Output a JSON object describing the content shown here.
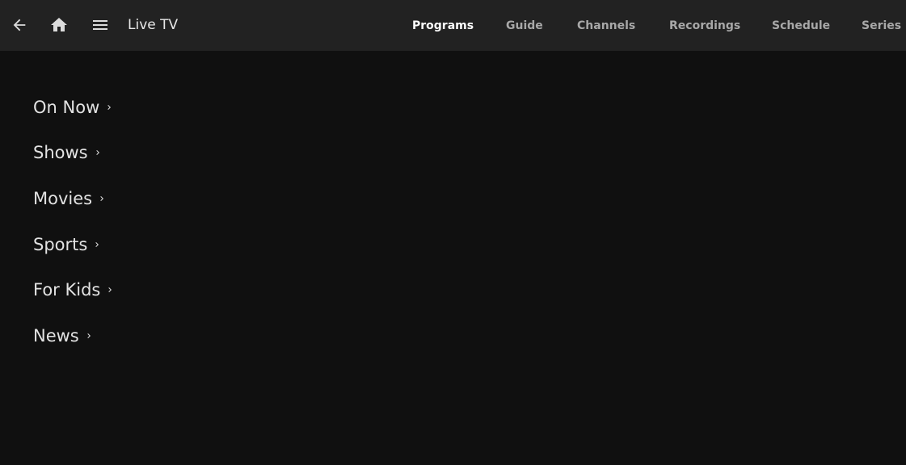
{
  "header": {
    "title": "Live TV",
    "icons": {
      "back": "arrow-back-icon",
      "home": "home-icon",
      "menu": "hamburger-menu-icon"
    },
    "tabs": [
      {
        "label": "Programs",
        "active": true
      },
      {
        "label": "Guide",
        "active": false
      },
      {
        "label": "Channels",
        "active": false
      },
      {
        "label": "Recordings",
        "active": false
      },
      {
        "label": "Schedule",
        "active": false
      },
      {
        "label": "Series",
        "active": false
      }
    ]
  },
  "sections": [
    {
      "label": "On Now"
    },
    {
      "label": "Shows"
    },
    {
      "label": "Movies"
    },
    {
      "label": "Sports"
    },
    {
      "label": "For Kids"
    },
    {
      "label": "News"
    }
  ],
  "colors": {
    "background": "#101010",
    "header_background": "#222222",
    "active_tab": "#ffffff",
    "inactive_tab": "#a8a8a8",
    "text": "#e2e2e2"
  }
}
